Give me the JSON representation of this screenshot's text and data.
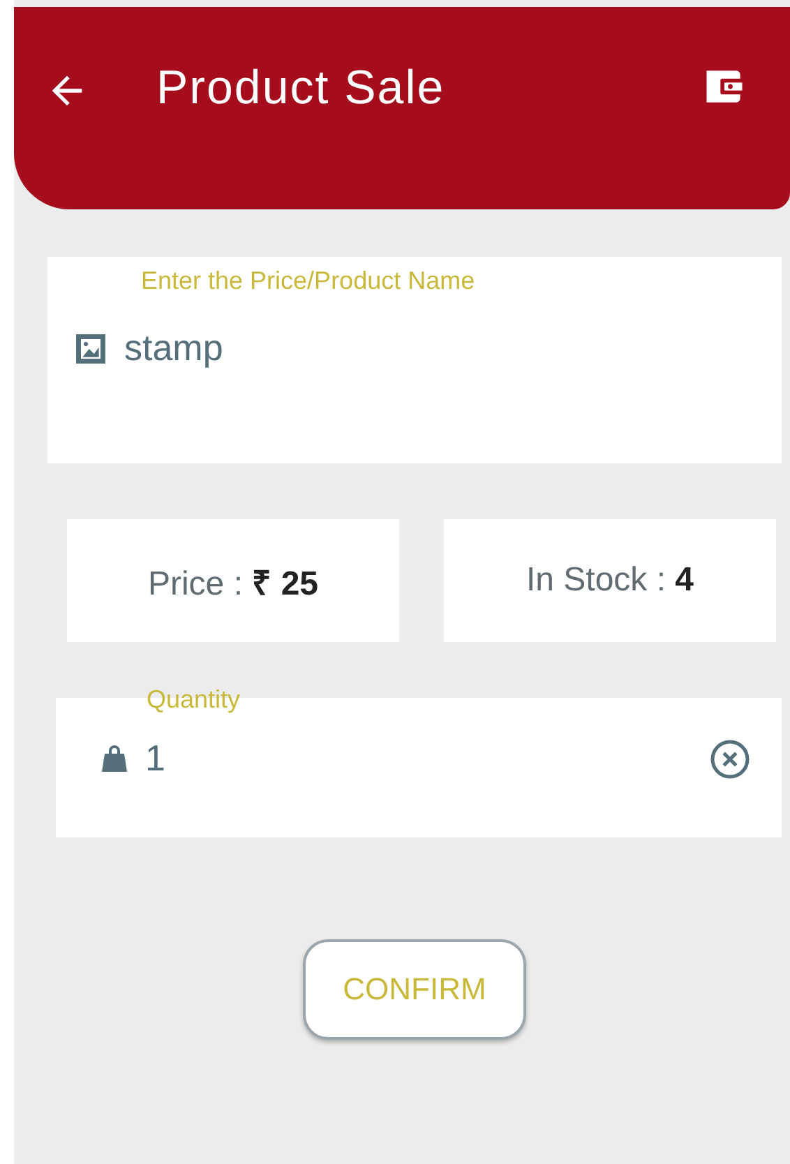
{
  "header": {
    "title": "Product Sale"
  },
  "product_field": {
    "label": "Enter the Price/Product Name",
    "value": "stamp"
  },
  "info_cards": [
    {
      "text": "Price : **₹ 25**"
    },
    {
      "text": "In Stock : **4**"
    }
  ],
  "quantity_field": {
    "label": "Quantity",
    "value": "1"
  },
  "confirm_button": {
    "label": "CONFIRM"
  }
}
